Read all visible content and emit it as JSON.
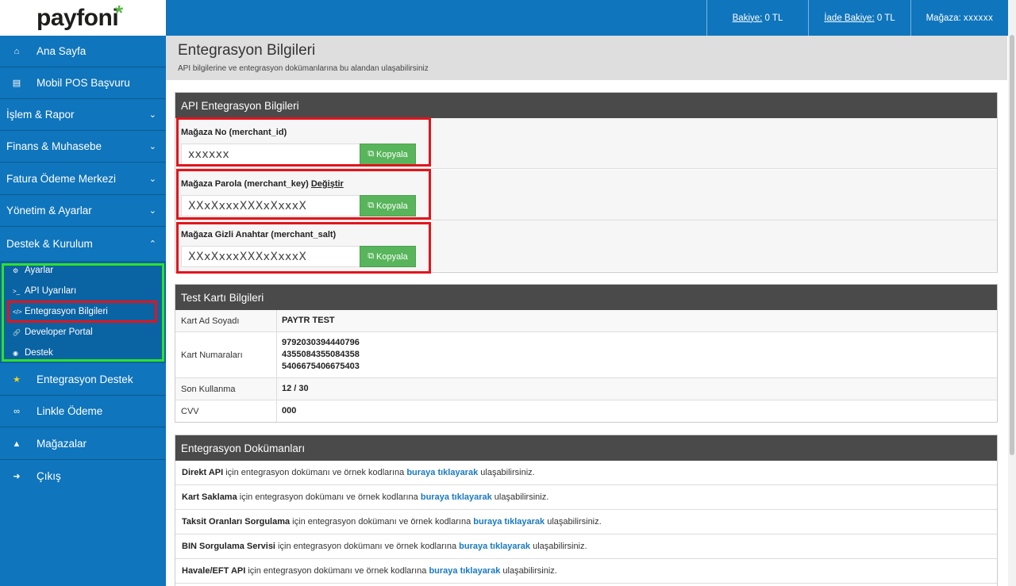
{
  "brand": {
    "logo_text": "payfoni",
    "logo_star": "*"
  },
  "sidebar": {
    "items": [
      {
        "label": "Ana Sayfa",
        "icon": "home-icon"
      },
      {
        "label": "Mobil POS Başvuru",
        "icon": "card-icon"
      },
      {
        "label": "İşlem & Rapor"
      },
      {
        "label": "Finans & Muhasebe"
      },
      {
        "label": "Fatura Ödeme Merkezi"
      },
      {
        "label": "Yönetim & Ayarlar"
      },
      {
        "label": "Destek & Kurulum"
      }
    ],
    "submenu": [
      {
        "label": "Ayarlar"
      },
      {
        "label": "API Uyarıları"
      },
      {
        "label": "Entegrasyon Bilgileri"
      },
      {
        "label": "Developer Portal"
      },
      {
        "label": "Destek"
      }
    ],
    "bottom_items": [
      {
        "label": "Entegrasyon Destek",
        "icon": "star-icon"
      },
      {
        "label": "Linkle Ödeme",
        "icon": "link-icon"
      },
      {
        "label": "Mağazalar",
        "icon": "sitemap-icon"
      },
      {
        "label": "Çıkış",
        "icon": "logout-icon"
      }
    ]
  },
  "topbar": {
    "balance_label": "Bakiye:",
    "balance_value": "0 TL",
    "refund_label": "İade Bakiye:",
    "refund_value": "0 TL",
    "store_label": "Mağaza:",
    "store_value": "xxxxxx"
  },
  "page": {
    "title": "Entegrasyon Bilgileri",
    "subtitle": "API bilgilerine ve entegrasyon dokümanlarına bu alandan ulaşabilirsiniz"
  },
  "api": {
    "heading": "API Entegrasyon Bilgileri",
    "copy_label": "Kopyala",
    "change_label": "Değiştir",
    "fields": [
      {
        "label": "Mağaza No (merchant_id)",
        "value": "xxxxxx"
      },
      {
        "label": "Mağaza Parola (merchant_key)",
        "value": "XXxXxxxXXXxXxxxX"
      },
      {
        "label": "Mağaza Gizli Anahtar (merchant_salt)",
        "value": "XXxXxxxXXXxXxxxX"
      }
    ]
  },
  "test_card": {
    "heading": "Test Kartı Bilgileri",
    "rows": [
      {
        "key": "Kart Ad Soyadı",
        "values": [
          "PAYTR TEST"
        ]
      },
      {
        "key": "Kart Numaraları",
        "values": [
          "9792030394440796",
          "4355084355084358",
          "5406675406675403"
        ]
      },
      {
        "key": "Son Kullanma",
        "values": [
          "12 / 30"
        ]
      },
      {
        "key": "CVV",
        "values": [
          "000"
        ]
      }
    ]
  },
  "docs": {
    "heading": "Entegrasyon Dokümanları",
    "middle_text": " için entegrasyon dokümanı ve örnek kodlarına ",
    "link_text": "buraya tıklayarak",
    "end_text": " ulaşabilirsiniz.",
    "rows": [
      {
        "name": "Direkt API"
      },
      {
        "name": "Kart Saklama"
      },
      {
        "name": "Taksit Oranları Sorgulama"
      },
      {
        "name": "BIN Sorgulama Servisi"
      },
      {
        "name": "Havale/EFT API"
      }
    ]
  },
  "colors": {
    "sidebar": "#0f75bc",
    "accent_green": "#58b55b",
    "highlight_red": "#e3141b",
    "highlight_green": "#2fe02a",
    "panel_head": "#4a4a4a",
    "link": "#1a79c2"
  }
}
